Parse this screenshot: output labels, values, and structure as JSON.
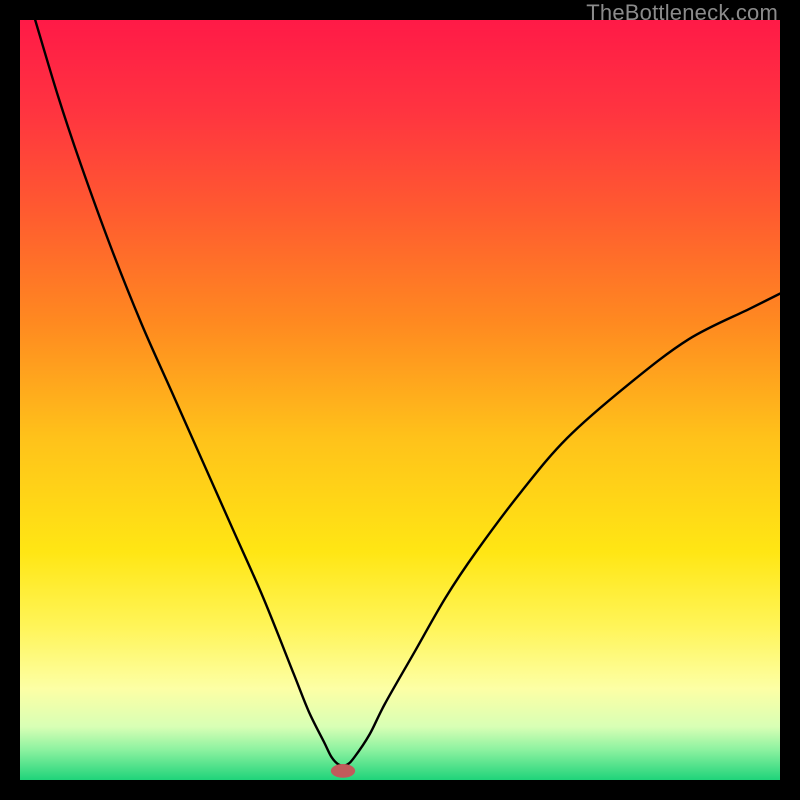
{
  "watermark": "TheBottleneck.com",
  "chart_data": {
    "type": "line",
    "title": "",
    "xlabel": "",
    "ylabel": "",
    "xlim": [
      0,
      100
    ],
    "ylim": [
      0,
      100
    ],
    "grid": false,
    "background_gradient": {
      "stops": [
        {
          "offset": 0.0,
          "color": "#ff1a47"
        },
        {
          "offset": 0.12,
          "color": "#ff3440"
        },
        {
          "offset": 0.25,
          "color": "#ff5a30"
        },
        {
          "offset": 0.4,
          "color": "#ff8a20"
        },
        {
          "offset": 0.55,
          "color": "#ffc21a"
        },
        {
          "offset": 0.7,
          "color": "#ffe614"
        },
        {
          "offset": 0.8,
          "color": "#fff55a"
        },
        {
          "offset": 0.88,
          "color": "#fdffa5"
        },
        {
          "offset": 0.93,
          "color": "#d8ffb5"
        },
        {
          "offset": 0.96,
          "color": "#8df2a0"
        },
        {
          "offset": 1.0,
          "color": "#1fd47a"
        }
      ]
    },
    "series": [
      {
        "name": "curve",
        "stroke": "#000000",
        "stroke_width": 2.4,
        "x": [
          2,
          5,
          8,
          12,
          16,
          20,
          24,
          28,
          32,
          36,
          38,
          40,
          41,
          42,
          43,
          44,
          46,
          48,
          52,
          56,
          60,
          66,
          72,
          80,
          88,
          96,
          100
        ],
        "y": [
          100,
          90,
          81,
          70,
          60,
          51,
          42,
          33,
          24,
          14,
          9,
          5,
          3,
          2,
          2,
          3,
          6,
          10,
          17,
          24,
          30,
          38,
          45,
          52,
          58,
          62,
          64
        ]
      }
    ],
    "marker": {
      "name": "min-marker",
      "cx": 42.5,
      "cy": 1.2,
      "rx": 1.6,
      "ry": 0.9,
      "fill": "#c15b5b"
    }
  }
}
